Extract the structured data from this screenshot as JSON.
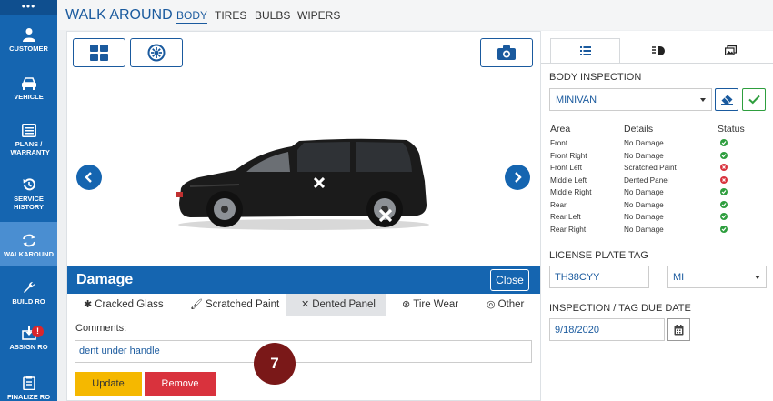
{
  "sidebar": {
    "top_glyph": "•••",
    "items": [
      {
        "label": "CUSTOMER",
        "icon": "person-icon"
      },
      {
        "label": "VEHICLE",
        "icon": "car-icon"
      },
      {
        "label": "PLANS / WARRANTY",
        "icon": "list-icon"
      },
      {
        "label": "SERVICE HISTORY",
        "icon": "history-icon"
      },
      {
        "label": "WALKAROUND",
        "icon": "refresh-icon"
      },
      {
        "label": "BUILD RO",
        "icon": "wrench-icon"
      },
      {
        "label": "ASSIGN RO",
        "icon": "download-icon",
        "badge": "!"
      },
      {
        "label": "FINALIZE RO",
        "icon": "clipboard-icon"
      }
    ]
  },
  "header": {
    "title": "WALK AROUND",
    "tabs": [
      {
        "label": "BODY",
        "active": true
      },
      {
        "label": "TIRES"
      },
      {
        "label": "BULBS"
      },
      {
        "label": "WIPERS"
      }
    ]
  },
  "damage": {
    "title": "Damage",
    "close_label": "Close",
    "tabs": [
      {
        "label": "Cracked Glass",
        "icon": "asterisk-icon"
      },
      {
        "label": "Scratched Paint",
        "icon": "brush-icon"
      },
      {
        "label": "Dented Panel",
        "icon": "x-icon",
        "active": true
      },
      {
        "label": "Tire Wear",
        "icon": "tire-icon"
      },
      {
        "label": "Other",
        "icon": "target-icon"
      }
    ],
    "comments_label": "Comments:",
    "comments_value": "dent under handle",
    "update_label": "Update",
    "remove_label": "Remove",
    "step_number": "7"
  },
  "right": {
    "body_inspection_label": "BODY INSPECTION",
    "vehicle_type": "MINIVAN",
    "table": {
      "headers": [
        "Area",
        "Details",
        "Status"
      ],
      "rows": [
        {
          "area": "Front",
          "details": "No Damage",
          "status": "ok"
        },
        {
          "area": "Front Right",
          "details": "No Damage",
          "status": "ok"
        },
        {
          "area": "Front Left",
          "details": "Scratched Paint",
          "status": "damage"
        },
        {
          "area": "Middle Left",
          "details": "Dented Panel",
          "status": "damage"
        },
        {
          "area": "Middle Right",
          "details": "No Damage",
          "status": "ok"
        },
        {
          "area": "Rear",
          "details": "No Damage",
          "status": "ok"
        },
        {
          "area": "Rear Left",
          "details": "No Damage",
          "status": "ok"
        },
        {
          "area": "Rear Right",
          "details": "No Damage",
          "status": "ok"
        }
      ]
    },
    "license_plate_label": "LICENSE PLATE TAG",
    "license_plate_value": "TH38CYY",
    "state_value": "MI",
    "due_date_label": "INSPECTION / TAG DUE DATE",
    "due_date_value": "9/18/2020"
  },
  "colors": {
    "primary": "#1565b0",
    "sidebar_active": "#4a8ed1",
    "update": "#f5b800",
    "remove": "#d9323d",
    "ok": "#2e9e3e",
    "step": "#7a1818"
  }
}
